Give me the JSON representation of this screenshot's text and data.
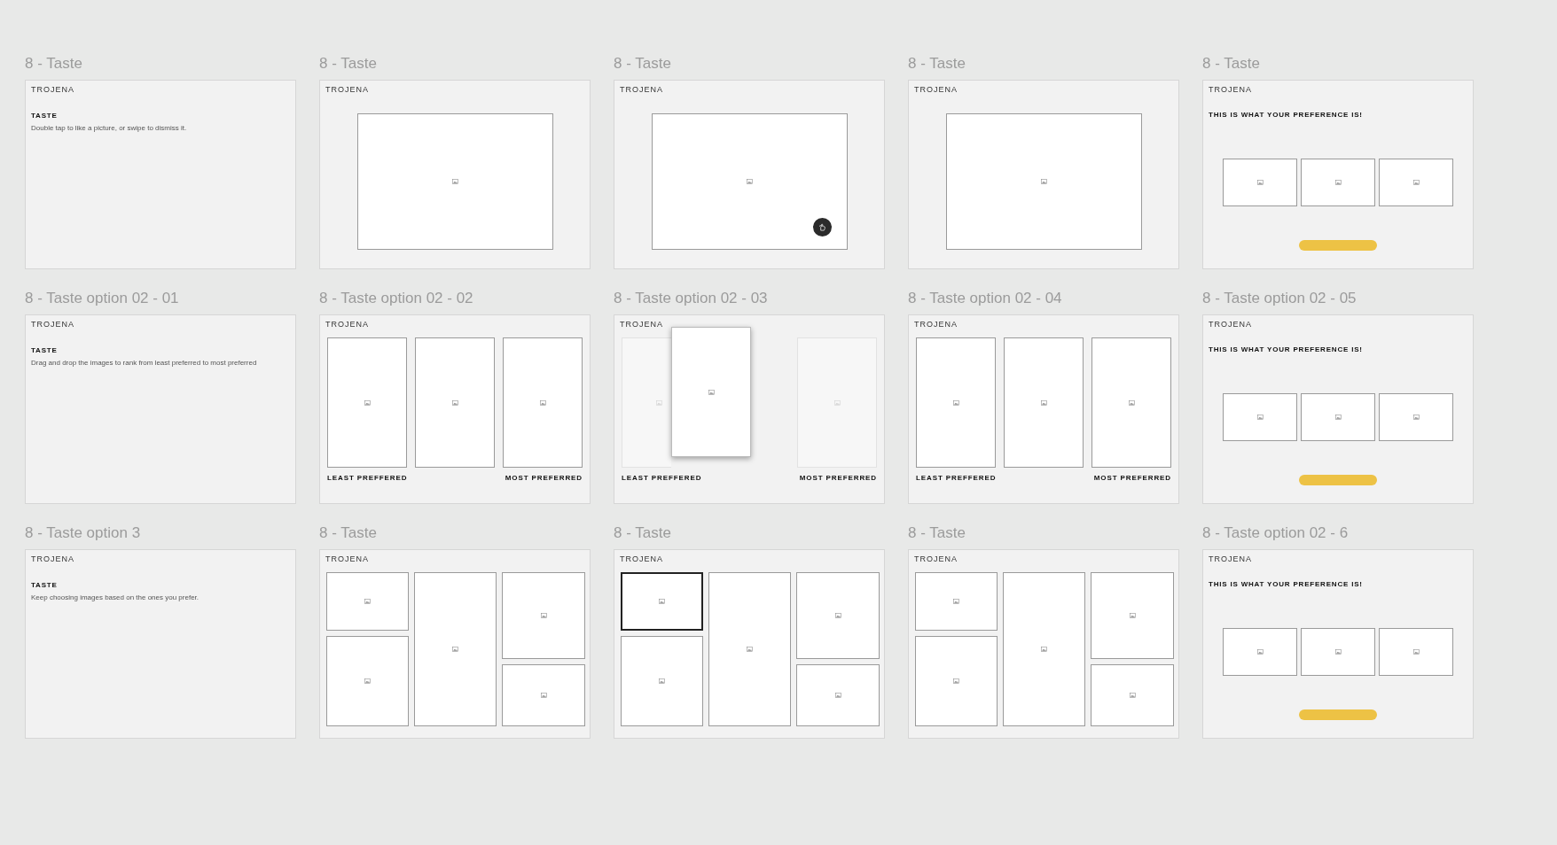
{
  "canvas": {
    "artboards": [
      {
        "title": "8 - Taste",
        "kind": "intro",
        "brand": "TROJENA",
        "heading": "TASTE",
        "text": "Double tap to like a picture, or swipe to dismiss it."
      },
      {
        "title": "8 - Taste",
        "kind": "single",
        "brand": "TROJENA",
        "like_button": false
      },
      {
        "title": "8 - Taste",
        "kind": "single",
        "brand": "TROJENA",
        "like_button": true
      },
      {
        "title": "8 - Taste",
        "kind": "single",
        "brand": "TROJENA",
        "like_button": false
      },
      {
        "title": "8 - Taste",
        "kind": "result",
        "brand": "TROJENA",
        "heading": "THIS IS WHAT YOUR PREFERENCE IS!"
      },
      {
        "title": "8 - Taste option 02 - 01",
        "kind": "intro",
        "brand": "TROJENA",
        "heading": "TASTE",
        "text": "Drag and drop the images to rank from least preferred to most preferred"
      },
      {
        "title": "8 - Taste option 02 - 02",
        "kind": "rank",
        "brand": "TROJENA",
        "lifted": false,
        "slots": [
          {
            "kind": "frame"
          },
          {
            "kind": "frame"
          },
          {
            "kind": "frame"
          }
        ],
        "left_label": "LEAST PREFFERED",
        "right_label": "MOST PREFERRED"
      },
      {
        "title": "8 - Taste option 02 - 03",
        "kind": "rank",
        "brand": "TROJENA",
        "lifted": true,
        "slots": [
          {
            "kind": "ghost"
          },
          {
            "kind": "empty"
          },
          {
            "kind": "ghost"
          }
        ],
        "left_label": "LEAST PREFFERED",
        "right_label": "MOST PREFERRED"
      },
      {
        "title": "8 - Taste option 02 - 04",
        "kind": "rank",
        "brand": "TROJENA",
        "lifted": false,
        "slots": [
          {
            "kind": "frame"
          },
          {
            "kind": "frame"
          },
          {
            "kind": "frame"
          }
        ],
        "left_label": "LEAST PREFFERED",
        "right_label": "MOST PREFERRED"
      },
      {
        "title": "8 - Taste option 02 - 05",
        "kind": "result",
        "brand": "TROJENA",
        "heading": "THIS IS WHAT YOUR PREFERENCE IS!"
      },
      {
        "title": "8 - Taste option 3",
        "kind": "intro",
        "brand": "TROJENA",
        "heading": "TASTE",
        "text": "Keep choosing images based on the ones you prefer."
      },
      {
        "title": "8 - Taste",
        "kind": "mosaic",
        "brand": "TROJENA",
        "tiles": [
          {
            "selected": false
          },
          {
            "selected": false
          },
          {
            "selected": false
          },
          {
            "selected": false
          },
          {
            "selected": false
          }
        ]
      },
      {
        "title": "8 - Taste",
        "kind": "mosaic",
        "brand": "TROJENA",
        "tiles": [
          {
            "selected": true
          },
          {
            "selected": false
          },
          {
            "selected": false
          },
          {
            "selected": false
          },
          {
            "selected": false
          }
        ]
      },
      {
        "title": "8 - Taste",
        "kind": "mosaic",
        "brand": "TROJENA",
        "tiles": [
          {
            "selected": false
          },
          {
            "selected": false
          },
          {
            "selected": false
          },
          {
            "selected": false
          },
          {
            "selected": false
          }
        ]
      },
      {
        "title": "8 - Taste option 02 - 6",
        "kind": "result",
        "brand": "TROJENA",
        "heading": "THIS IS WHAT YOUR PREFERENCE IS!"
      }
    ]
  }
}
